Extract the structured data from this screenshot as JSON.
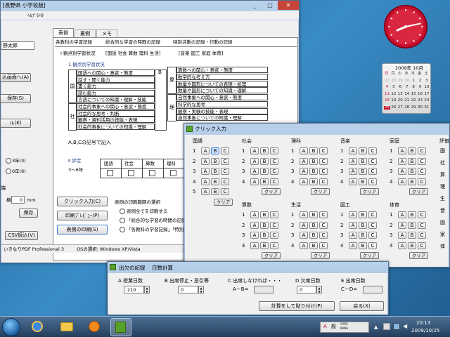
{
  "main_window": {
    "title": "[長野県 小学校版]",
    "menu": [
      "ﾍﾙﾌﾟ(H)"
    ],
    "student_name": "野太郎",
    "left_buttons": [
      "込画面へ(A)",
      "保存(S)",
      "ル(K)"
    ],
    "radio_options": [
      "3年(3)",
      "6年(6)"
    ],
    "margin_label": "端",
    "margin_value": "0",
    "margin_unit": "mm",
    "side_label": "横",
    "save_label": "保存",
    "csv_label": "CSV読込(V)",
    "tabs": [
      "表側",
      "裏側",
      "メモ"
    ],
    "section_tabs": [
      "各教科の学習記録",
      "総合的な学習の時間の記録",
      "特別活動の記録・行動の記録"
    ],
    "subject_tabs": [
      "Ⅰ 観点別学習状況",
      "[国語 社会 算数 理科 生活]",
      "[音楽 図工 家庭 体育]"
    ],
    "kanten_heading": "1 観点別学習状況",
    "col_b_header": "B",
    "left_table": [
      {
        "subject": "国",
        "items": [
          "国語への関心・意欲・態度",
          "話す・聞く能力",
          "書く能力",
          "読む能力",
          "言語についての知識・理解・技能"
        ]
      },
      {
        "subject": "社",
        "items": [
          "社会的事象への関心・意欲・態度",
          "社会的な思考・判断",
          "観察・資料活用の技能・表現",
          "社会的事象についての知識・理解"
        ]
      }
    ],
    "right_table": [
      {
        "subject": "算",
        "items": [
          "算数への関心・意欲・態度",
          "数学的な考え方",
          "数量や図形についての表現・処理",
          "数量や図形についての知識・理解"
        ]
      },
      {
        "subject": "理",
        "items": [
          "自然事象への関心・意欲・態度",
          "科学的な思考",
          "観察・実験の技能・表現",
          "自然事象についての知識・理解"
        ]
      }
    ],
    "note": "A,B,Cの記号で記入",
    "evaluation_heading": "Ⅱ 評定",
    "evaluation_grades": "3～6年",
    "evaluation_subjects": [
      "国語",
      "社会",
      "算数",
      "理科"
    ],
    "bottom_buttons": [
      "クリック入力(C)",
      "印刷ﾌﾟﾚﾋﾞｭｰ(P)",
      "表側の印刷(S)"
    ],
    "print_range_label": "表側の印刷範囲の選択",
    "print_options": [
      "表側全てを印刷する",
      "「総合的な学習の時間の記録",
      "「各教科の学習記録」「特別"
    ],
    "status_bar": [
      "いきなりPDF Professional 3",
      "OSの選択: Windows XP/Vista"
    ]
  },
  "clock": {
    "hour": 8,
    "minute": 13
  },
  "calendar": {
    "title": "2009年 10月",
    "weekdays": [
      "日",
      "月",
      "火",
      "水",
      "木",
      "金",
      "土"
    ],
    "rows": [
      [
        "27",
        "28",
        "29",
        "30",
        "1",
        "2",
        "3"
      ],
      [
        "4",
        "5",
        "6",
        "7",
        "8",
        "9",
        "10"
      ],
      [
        "11",
        "12",
        "13",
        "14",
        "15",
        "16",
        "17"
      ],
      [
        "18",
        "19",
        "20",
        "21",
        "22",
        "23",
        "24"
      ],
      [
        "25",
        "26",
        "27",
        "28",
        "29",
        "30",
        "31"
      ]
    ],
    "today": "25"
  },
  "click_input": {
    "title": "クリック入力",
    "choices": [
      "A",
      "B",
      "C"
    ],
    "clear_label": "クリア",
    "groups": [
      {
        "name": "国語",
        "rows": [
          "1",
          "2",
          "3",
          "4",
          "5"
        ],
        "selected": {
          "row": 0,
          "choice": "B"
        }
      },
      {
        "name": "社会",
        "rows": [
          "1",
          "2",
          "3",
          "4"
        ]
      },
      {
        "name": "理科",
        "rows": [
          "1",
          "2",
          "3",
          "4"
        ]
      },
      {
        "name": "音楽",
        "rows": [
          "1",
          "2",
          "3",
          "4"
        ]
      },
      {
        "name": "家庭",
        "rows": [
          "1",
          "2",
          "3",
          "4"
        ]
      },
      {
        "name": "算数",
        "rows": [
          "1",
          "2",
          "3",
          "4"
        ]
      },
      {
        "name": "生活",
        "rows": [
          "1",
          "2",
          "3",
          "4"
        ]
      },
      {
        "name": "図工",
        "rows": [
          "1",
          "2",
          "3",
          "4"
        ]
      },
      {
        "name": "体育",
        "rows": [
          "1",
          "2",
          "3",
          "4"
        ]
      }
    ],
    "side_label": "評価",
    "side_chars": [
      "国",
      "社",
      "算",
      "理",
      "生",
      "音",
      "図",
      "家",
      "体"
    ]
  },
  "attendance": {
    "title": "出欠の記録",
    "tab_label": "日数計算",
    "cols": [
      {
        "label": "A 授業日数",
        "value": "210"
      },
      {
        "label": "B 出席停止・忌引等",
        "value": "0"
      },
      {
        "label": "C 出席しなければ・・・",
        "formula": "A－B="
      },
      {
        "label": "D 欠席日数",
        "value": "0"
      },
      {
        "label": "E 出席日数",
        "formula": "C－D="
      }
    ],
    "calc_button": "計算をして貼り付け(P)",
    "back_button": "戻る(X)"
  },
  "taskbar": {
    "time": "20:13",
    "date": "2009/10/25",
    "tray_texts": [
      "A",
      "般",
      "CAPS",
      "KANA"
    ]
  },
  "colors": {
    "accent_red": "#c8102e",
    "title_blue": "#1a3a8a",
    "desktop": "#2b6fa6"
  }
}
